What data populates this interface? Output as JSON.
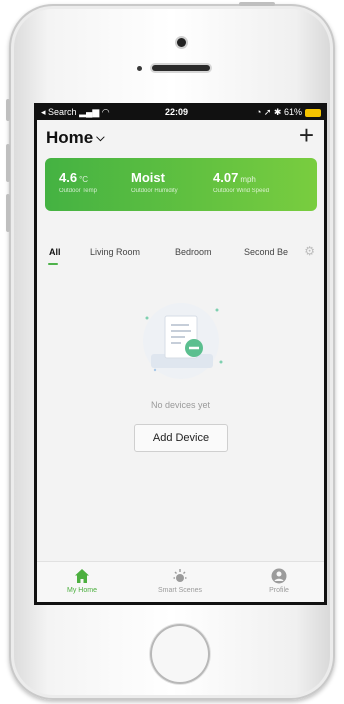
{
  "status_bar": {
    "carrier": "Search",
    "time": "22:09",
    "battery": "61%"
  },
  "header": {
    "title": "Home",
    "chevron_icon": "chevron-down-icon",
    "add_icon": "plus-icon"
  },
  "weather": {
    "temp": {
      "value": "4.6",
      "unit": "°C",
      "label": "Outdoor Temp"
    },
    "humidity": {
      "value": "Moist",
      "label": "Outdoor Humidity"
    },
    "wind": {
      "value": "4.07",
      "unit": "mph",
      "label": "Outdoor Wind Speed"
    }
  },
  "tabs": [
    {
      "label": "All",
      "active": true
    },
    {
      "label": "Living Room"
    },
    {
      "label": "Bedroom"
    },
    {
      "label": "Second Be"
    }
  ],
  "empty_state": {
    "message": "No devices yet",
    "button": "Add Device"
  },
  "tab_bar": [
    {
      "label": "My Home",
      "icon": "house-icon",
      "active": true
    },
    {
      "label": "Smart Scenes",
      "icon": "sun-icon"
    },
    {
      "label": "Profile",
      "icon": "person-icon"
    }
  ],
  "colors": {
    "accent": "#4caf3f",
    "weather_gradient_start": "#44b242",
    "weather_gradient_end": "#79cd3f"
  }
}
